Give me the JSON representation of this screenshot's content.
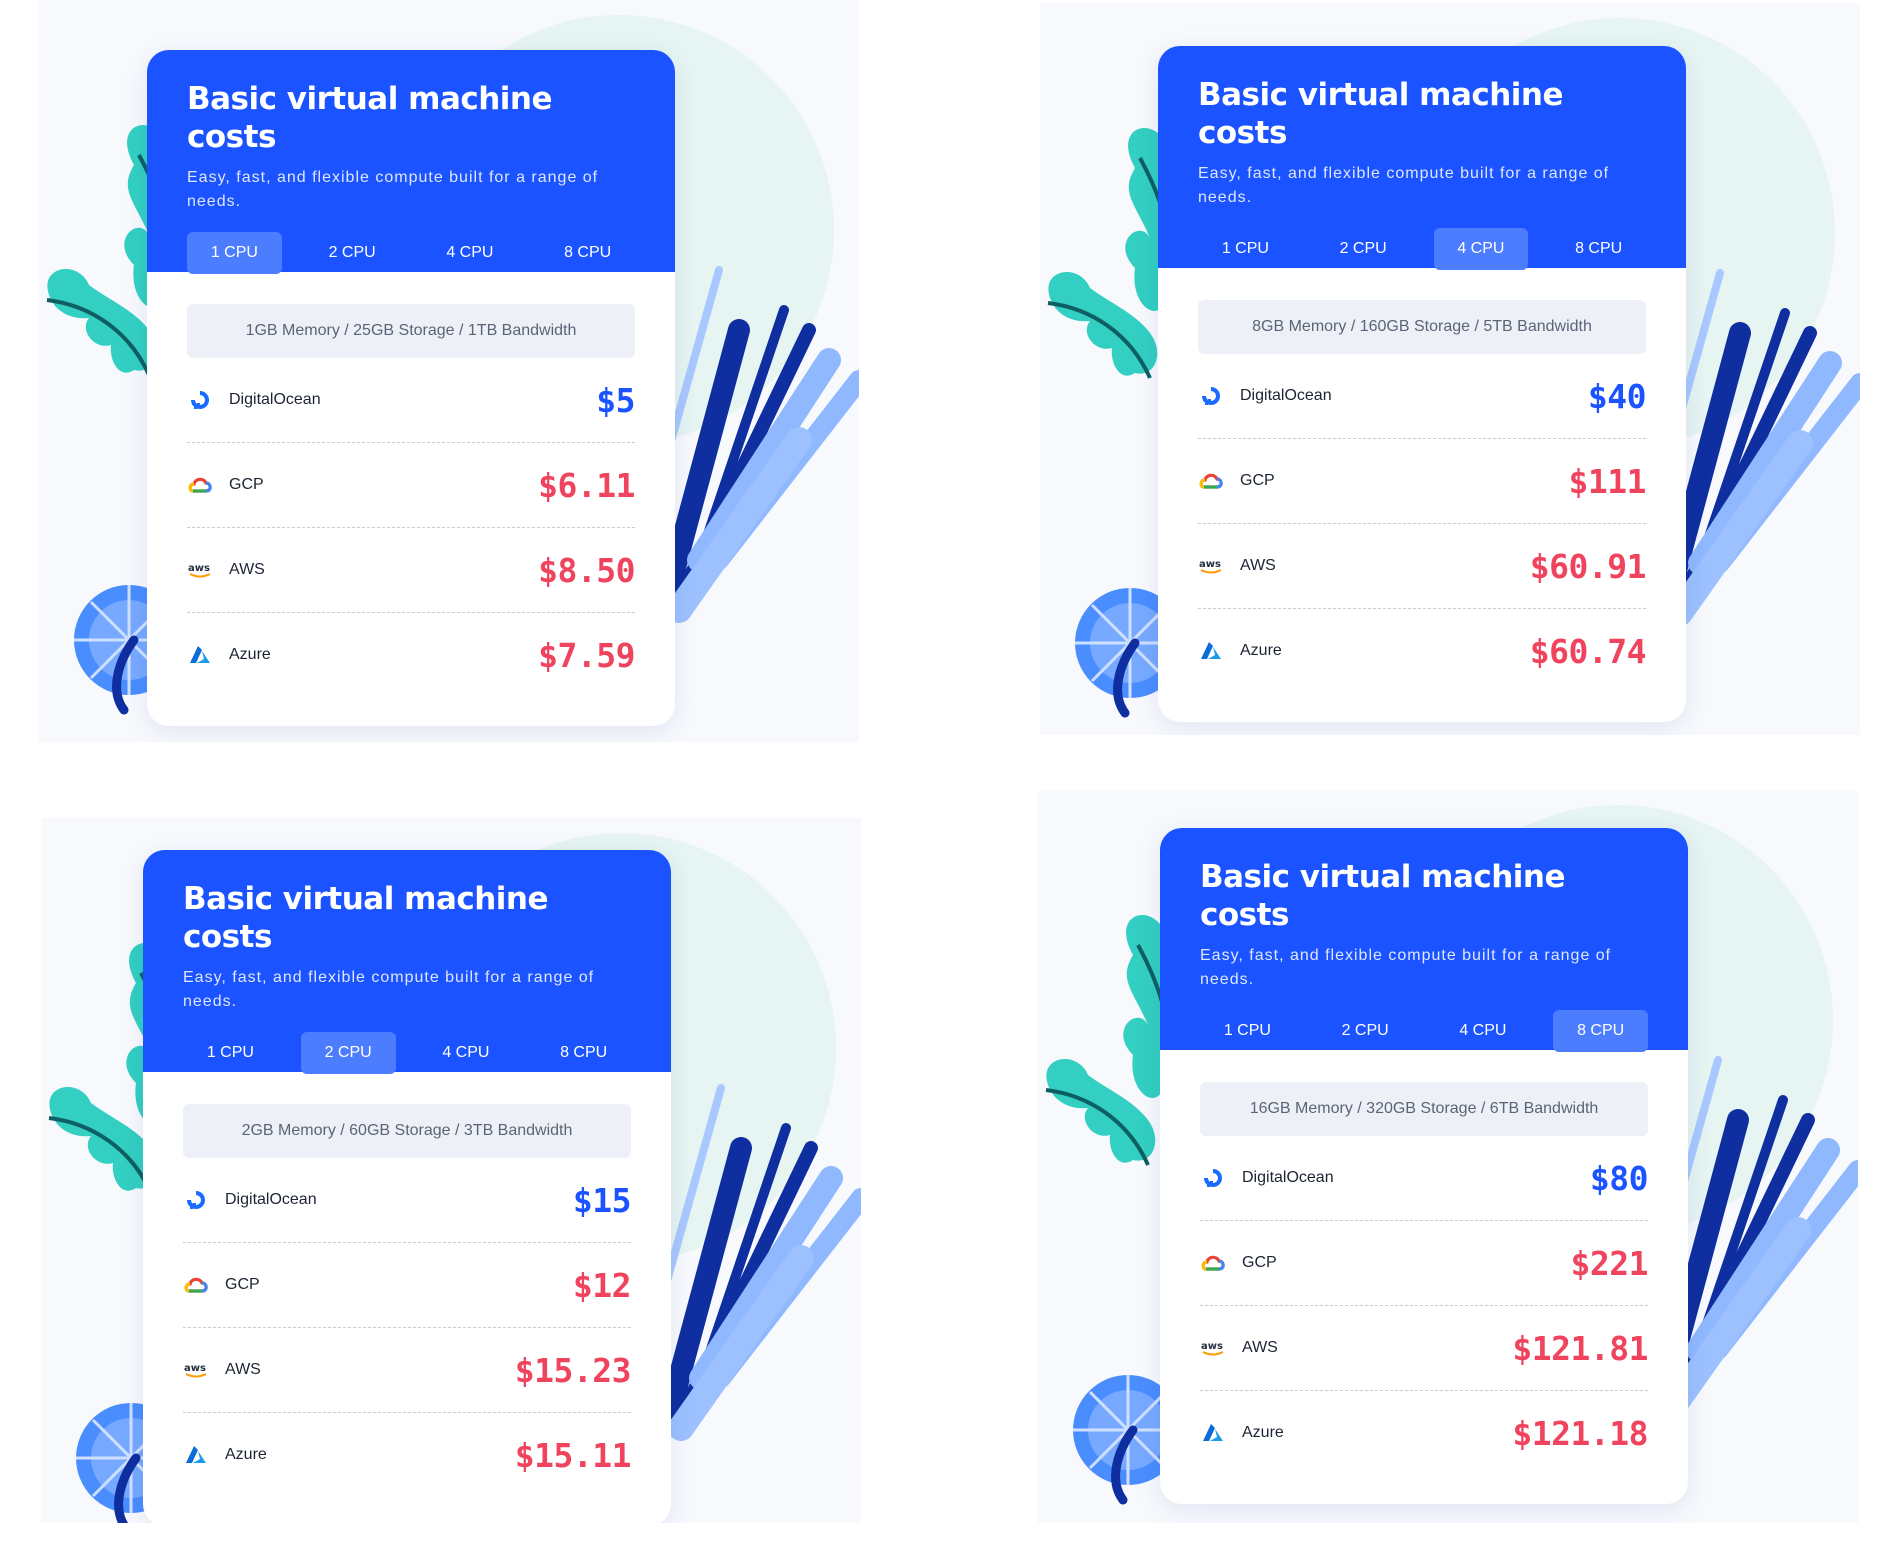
{
  "colors": {
    "brand_blue": "#1a53ff",
    "active_tab": "#4d7dff",
    "cheap_price": "#1a53ff",
    "expensive_price": "#f0435e",
    "teal_leaf": "#33cfc2"
  },
  "cards": [
    {
      "title": "Basic virtual machine costs",
      "subtitle": "Easy, fast, and flexible compute built for a range of needs.",
      "tabs": [
        "1 CPU",
        "2 CPU",
        "4 CPU",
        "8 CPU"
      ],
      "active_tab": "1 CPU",
      "spec": "1GB Memory / 25GB Storage / 1TB Bandwidth",
      "providers": [
        {
          "name": "DigitalOcean",
          "price": "$5",
          "icon": "digitalocean-icon"
        },
        {
          "name": "GCP",
          "price": "$6.11",
          "icon": "gcp-icon"
        },
        {
          "name": "AWS",
          "price": "$8.50",
          "icon": "aws-icon"
        },
        {
          "name": "Azure",
          "price": "$7.59",
          "icon": "azure-icon"
        }
      ]
    },
    {
      "title": "Basic virtual machine costs",
      "subtitle": "Easy, fast, and flexible compute built for a range of needs.",
      "tabs": [
        "1 CPU",
        "2 CPU",
        "4 CPU",
        "8 CPU"
      ],
      "active_tab": "4 CPU",
      "spec": "8GB Memory / 160GB Storage / 5TB Bandwidth",
      "providers": [
        {
          "name": "DigitalOcean",
          "price": "$40",
          "icon": "digitalocean-icon"
        },
        {
          "name": "GCP",
          "price": "$111",
          "icon": "gcp-icon"
        },
        {
          "name": "AWS",
          "price": "$60.91",
          "icon": "aws-icon"
        },
        {
          "name": "Azure",
          "price": "$60.74",
          "icon": "azure-icon"
        }
      ]
    },
    {
      "title": "Basic virtual machine costs",
      "subtitle": "Easy, fast, and flexible compute built for a range of needs.",
      "tabs": [
        "1 CPU",
        "2 CPU",
        "4 CPU",
        "8 CPU"
      ],
      "active_tab": "2 CPU",
      "spec": "2GB Memory / 60GB Storage / 3TB Bandwidth",
      "providers": [
        {
          "name": "DigitalOcean",
          "price": "$15",
          "icon": "digitalocean-icon"
        },
        {
          "name": "GCP",
          "price": "$12",
          "icon": "gcp-icon"
        },
        {
          "name": "AWS",
          "price": "$15.23",
          "icon": "aws-icon"
        },
        {
          "name": "Azure",
          "price": "$15.11",
          "icon": "azure-icon"
        }
      ]
    },
    {
      "title": "Basic virtual machine costs",
      "subtitle": "Easy, fast, and flexible compute built for a range of needs.",
      "tabs": [
        "1 CPU",
        "2 CPU",
        "4 CPU",
        "8 CPU"
      ],
      "active_tab": "8 CPU",
      "spec": "16GB Memory / 320GB Storage / 6TB Bandwidth",
      "providers": [
        {
          "name": "DigitalOcean",
          "price": "$80",
          "icon": "digitalocean-icon"
        },
        {
          "name": "GCP",
          "price": "$221",
          "icon": "gcp-icon"
        },
        {
          "name": "AWS",
          "price": "$121.81",
          "icon": "aws-icon"
        },
        {
          "name": "Azure",
          "price": "$121.18",
          "icon": "azure-icon"
        }
      ]
    }
  ]
}
